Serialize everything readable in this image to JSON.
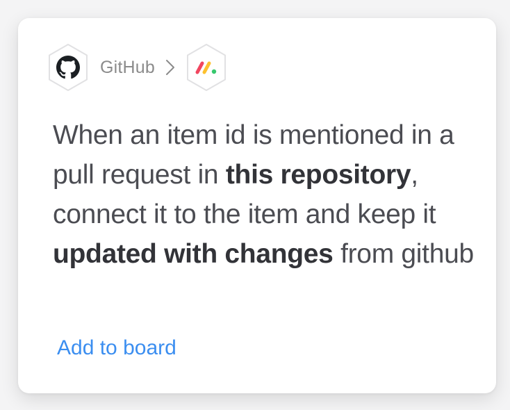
{
  "card": {
    "breadcrumb": {
      "source_name": "GitHub",
      "source_icon": "github-icon",
      "separator_icon": "chevron-right-icon",
      "target_icon": "monday-icon"
    },
    "description": {
      "part1": "When an item id is mentioned in a pull request in ",
      "bold1": "this repository",
      "part2": ", connect it to the item and keep it ",
      "bold2": "updated with changes",
      "part3": " from github"
    },
    "add_link_label": "Add to board"
  },
  "colors": {
    "link": "#3b8ef0",
    "text": "#323338",
    "muted": "#8b8b8b",
    "monday_red": "#f1465f",
    "monday_yellow": "#fdc12f",
    "monday_green": "#37c86e"
  }
}
